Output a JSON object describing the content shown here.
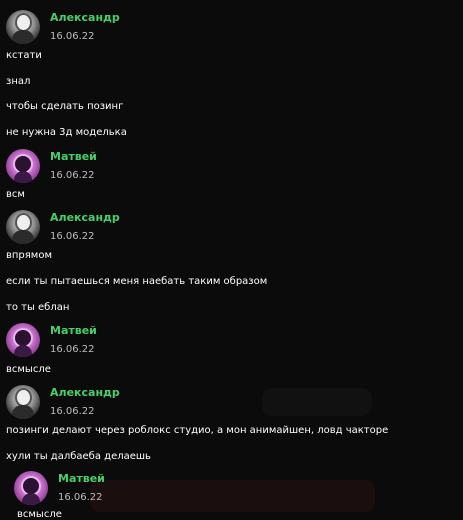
{
  "messages": [
    {
      "author": "Александр",
      "avatar_icon": "user-avatar-icon",
      "date": "16.06.22",
      "lines": [
        "кстати",
        "знал",
        "чтобы сделать позинг",
        "не нужна 3д моделька"
      ]
    },
    {
      "author": "Матвей",
      "avatar_icon": "user-avatar-icon",
      "date": "16.06.22",
      "lines": [
        "вcм"
      ]
    },
    {
      "author": "Александр",
      "avatar_icon": "user-avatar-icon",
      "date": "16.06.22",
      "lines": [
        "впрямом",
        "если ты пытаешься меня наебать таким образом",
        "то ты еблан"
      ]
    },
    {
      "author": "Матвей",
      "avatar_icon": "user-avatar-icon",
      "date": "16.06.22",
      "lines": [
        "всмысле"
      ]
    },
    {
      "author": "Александр",
      "avatar_icon": "user-avatar-icon",
      "date": "16.06.22",
      "lines": [
        "позинги делают через роблокс студио, а мон анимайшен, ловд чакторе",
        "хули ты далбаеба делаешь"
      ]
    },
    {
      "author": "Матвей",
      "avatar_icon": "user-avatar-icon",
      "date": "16.06.22",
      "lines": [
        "всмысле"
      ]
    }
  ],
  "colors": {
    "background": "#0b0b0b",
    "author_name": "#49cf6a",
    "date": "#bdbdbd",
    "message_text": "#ffffff"
  }
}
